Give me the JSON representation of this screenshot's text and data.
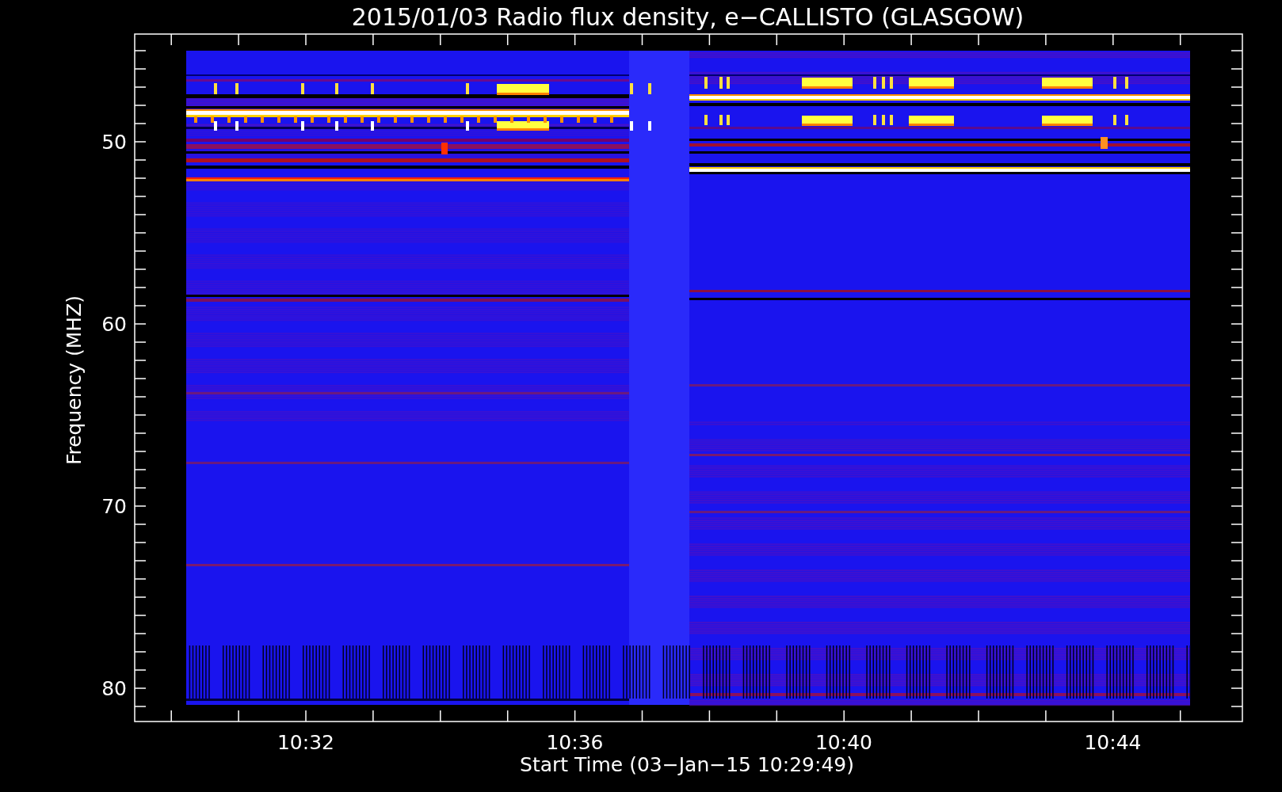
{
  "title": "2015/01/03  Radio flux density, e−CALLISTO (GLASGOW)",
  "y_axis": {
    "label": "Frequency (MHZ)",
    "tick_labels": [
      "50",
      "60",
      "70",
      "80"
    ]
  },
  "x_axis": {
    "label": "Start Time (03−Jan−15 10:29:49)",
    "tick_labels": [
      "10:32",
      "10:36",
      "10:40",
      "10:44"
    ]
  }
}
